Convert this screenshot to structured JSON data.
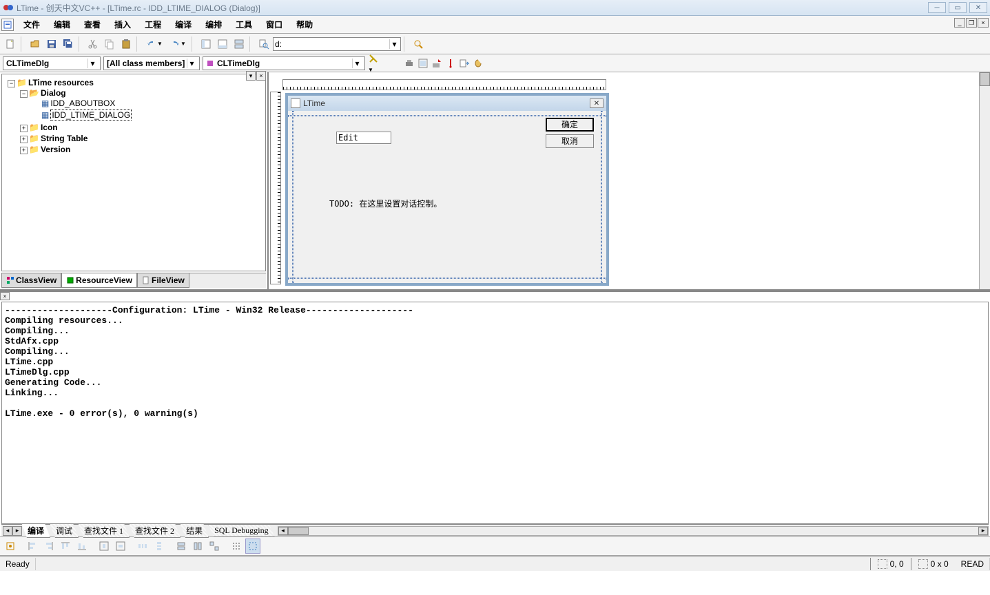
{
  "titlebar": {
    "text": "LTime - 创天中文VC++ - [LTime.rc - IDD_LTIME_DIALOG (Dialog)]"
  },
  "menu": {
    "items": [
      "文件",
      "编辑",
      "查看",
      "插入",
      "工程",
      "编译",
      "编排",
      "工具",
      "窗口",
      "帮助"
    ]
  },
  "toolbar": {
    "path_value": "d:"
  },
  "wizard": {
    "class_combo": "CLTimeDlg",
    "filter_combo": "[All class members]",
    "member_combo": "CLTimeDlg"
  },
  "tree": {
    "root": "LTime resources",
    "dialog": "Dialog",
    "dlg_about": "IDD_ABOUTBOX",
    "dlg_ltime": "IDD_LTIME_DIALOG",
    "icon": "Icon",
    "string_table": "String Table",
    "version": "Version"
  },
  "workspace_tabs": {
    "classview": "ClassView",
    "resourceview": "ResourceView",
    "fileview": "FileView"
  },
  "dialog_editor": {
    "title": "LTime",
    "edit_text": "Edit",
    "ok": "确定",
    "cancel": "取消",
    "todo": "TODO: 在这里设置对话控制。"
  },
  "output": {
    "text": "--------------------Configuration: LTime - Win32 Release--------------------\nCompiling resources...\nCompiling...\nStdAfx.cpp\nCompiling...\nLTime.cpp\nLTimeDlg.cpp\nGenerating Code...\nLinking...\n\nLTime.exe - 0 error(s), 0 warning(s)",
    "tabs": [
      "编译",
      "调试",
      "查找文件 1",
      "查找文件 2",
      "结果",
      "SQL Debugging"
    ]
  },
  "status": {
    "ready": "Ready",
    "pos": "0, 0",
    "size": "0 x 0",
    "read": "READ"
  }
}
